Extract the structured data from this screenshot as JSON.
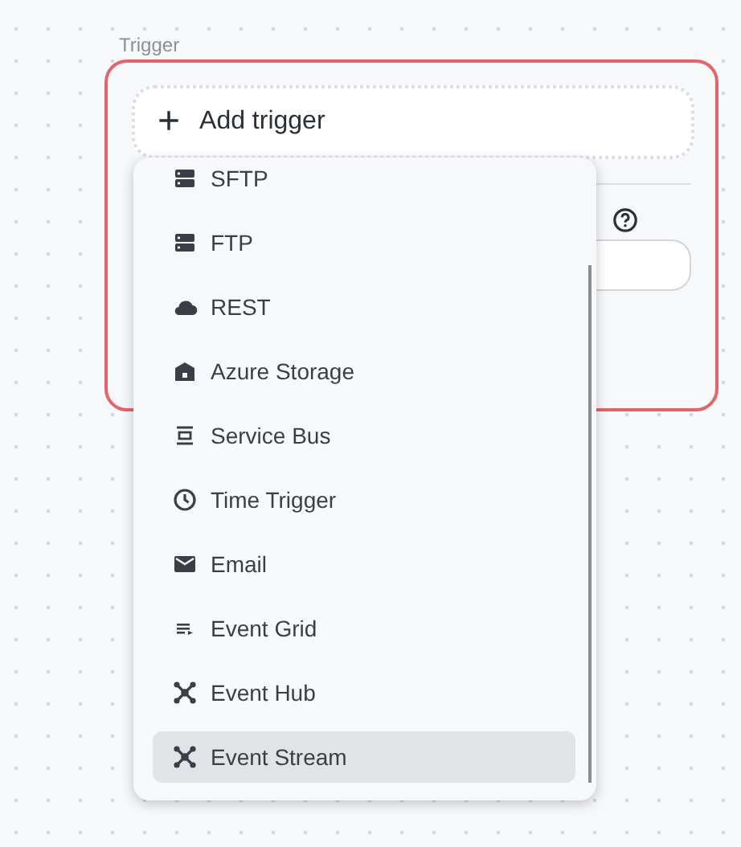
{
  "section_label": "Trigger",
  "add_button": {
    "icon": "+",
    "label": "Add trigger"
  },
  "menu": {
    "items": [
      {
        "label": "SFTP",
        "kind": "server",
        "selected": false
      },
      {
        "label": "FTP",
        "kind": "server",
        "selected": false
      },
      {
        "label": "REST",
        "kind": "cloud",
        "selected": false
      },
      {
        "label": "Azure Storage",
        "kind": "storage",
        "selected": false
      },
      {
        "label": "Service Bus",
        "kind": "bus",
        "selected": false
      },
      {
        "label": "Time Trigger",
        "kind": "clock",
        "selected": false
      },
      {
        "label": "Email",
        "kind": "mail",
        "selected": false
      },
      {
        "label": "Event Grid",
        "kind": "grid",
        "selected": false
      },
      {
        "label": "Event Hub",
        "kind": "hub",
        "selected": false
      },
      {
        "label": "Event Stream",
        "kind": "hub",
        "selected": true
      }
    ]
  }
}
